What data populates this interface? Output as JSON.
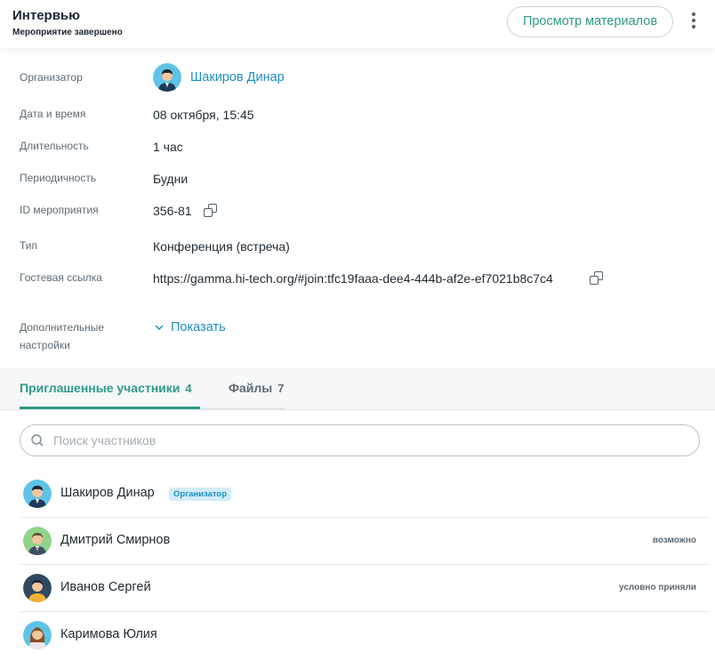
{
  "header": {
    "title": "Интервью",
    "subtitle": "Мероприятие завершено",
    "materials_button": "Просмотр материалов",
    "menu_icon": "more-vertical-icon"
  },
  "details": {
    "organizer_label": "Организатор",
    "organizer_name": "Шакиров Динар",
    "datetime_label": "Дата и время",
    "datetime_value": "08 октября, 15:45",
    "duration_label": "Длительность",
    "duration_value": "1 час",
    "recurrence_label": "Периодичность",
    "recurrence_value": "Будни",
    "id_label": "ID мероприятия",
    "id_value": "356-81",
    "type_label": "Тип",
    "type_value": "Конференция (встреча)",
    "guest_link_label": "Гостевая ссылка",
    "guest_link_value": "https://gamma.hi-tech.org/#join:tfc19faaa-dee4-444b-af2e-ef7021b8c7c4",
    "extra_label_line1": "Дополнительные",
    "extra_label_line2": "настройки",
    "show_label": "Показать"
  },
  "tabs": [
    {
      "label": "Приглашенные участники",
      "count": "4",
      "active": true
    },
    {
      "label": "Файлы",
      "count": "7",
      "active": false
    }
  ],
  "search": {
    "placeholder": "Поиск участников"
  },
  "participants": [
    {
      "name": "Шакиров Динар",
      "badge": "Организатор",
      "status": ""
    },
    {
      "name": "Дмитрий Смирнов",
      "badge": "",
      "status": "возможно"
    },
    {
      "name": "Иванов Сергей",
      "badge": "",
      "status": "условно приняли"
    },
    {
      "name": "Каримова Юлия",
      "badge": "",
      "status": ""
    }
  ],
  "colors": {
    "accent": "#2f9a86",
    "link": "#1d8fbf",
    "badge_bg": "#d3ecf8"
  }
}
